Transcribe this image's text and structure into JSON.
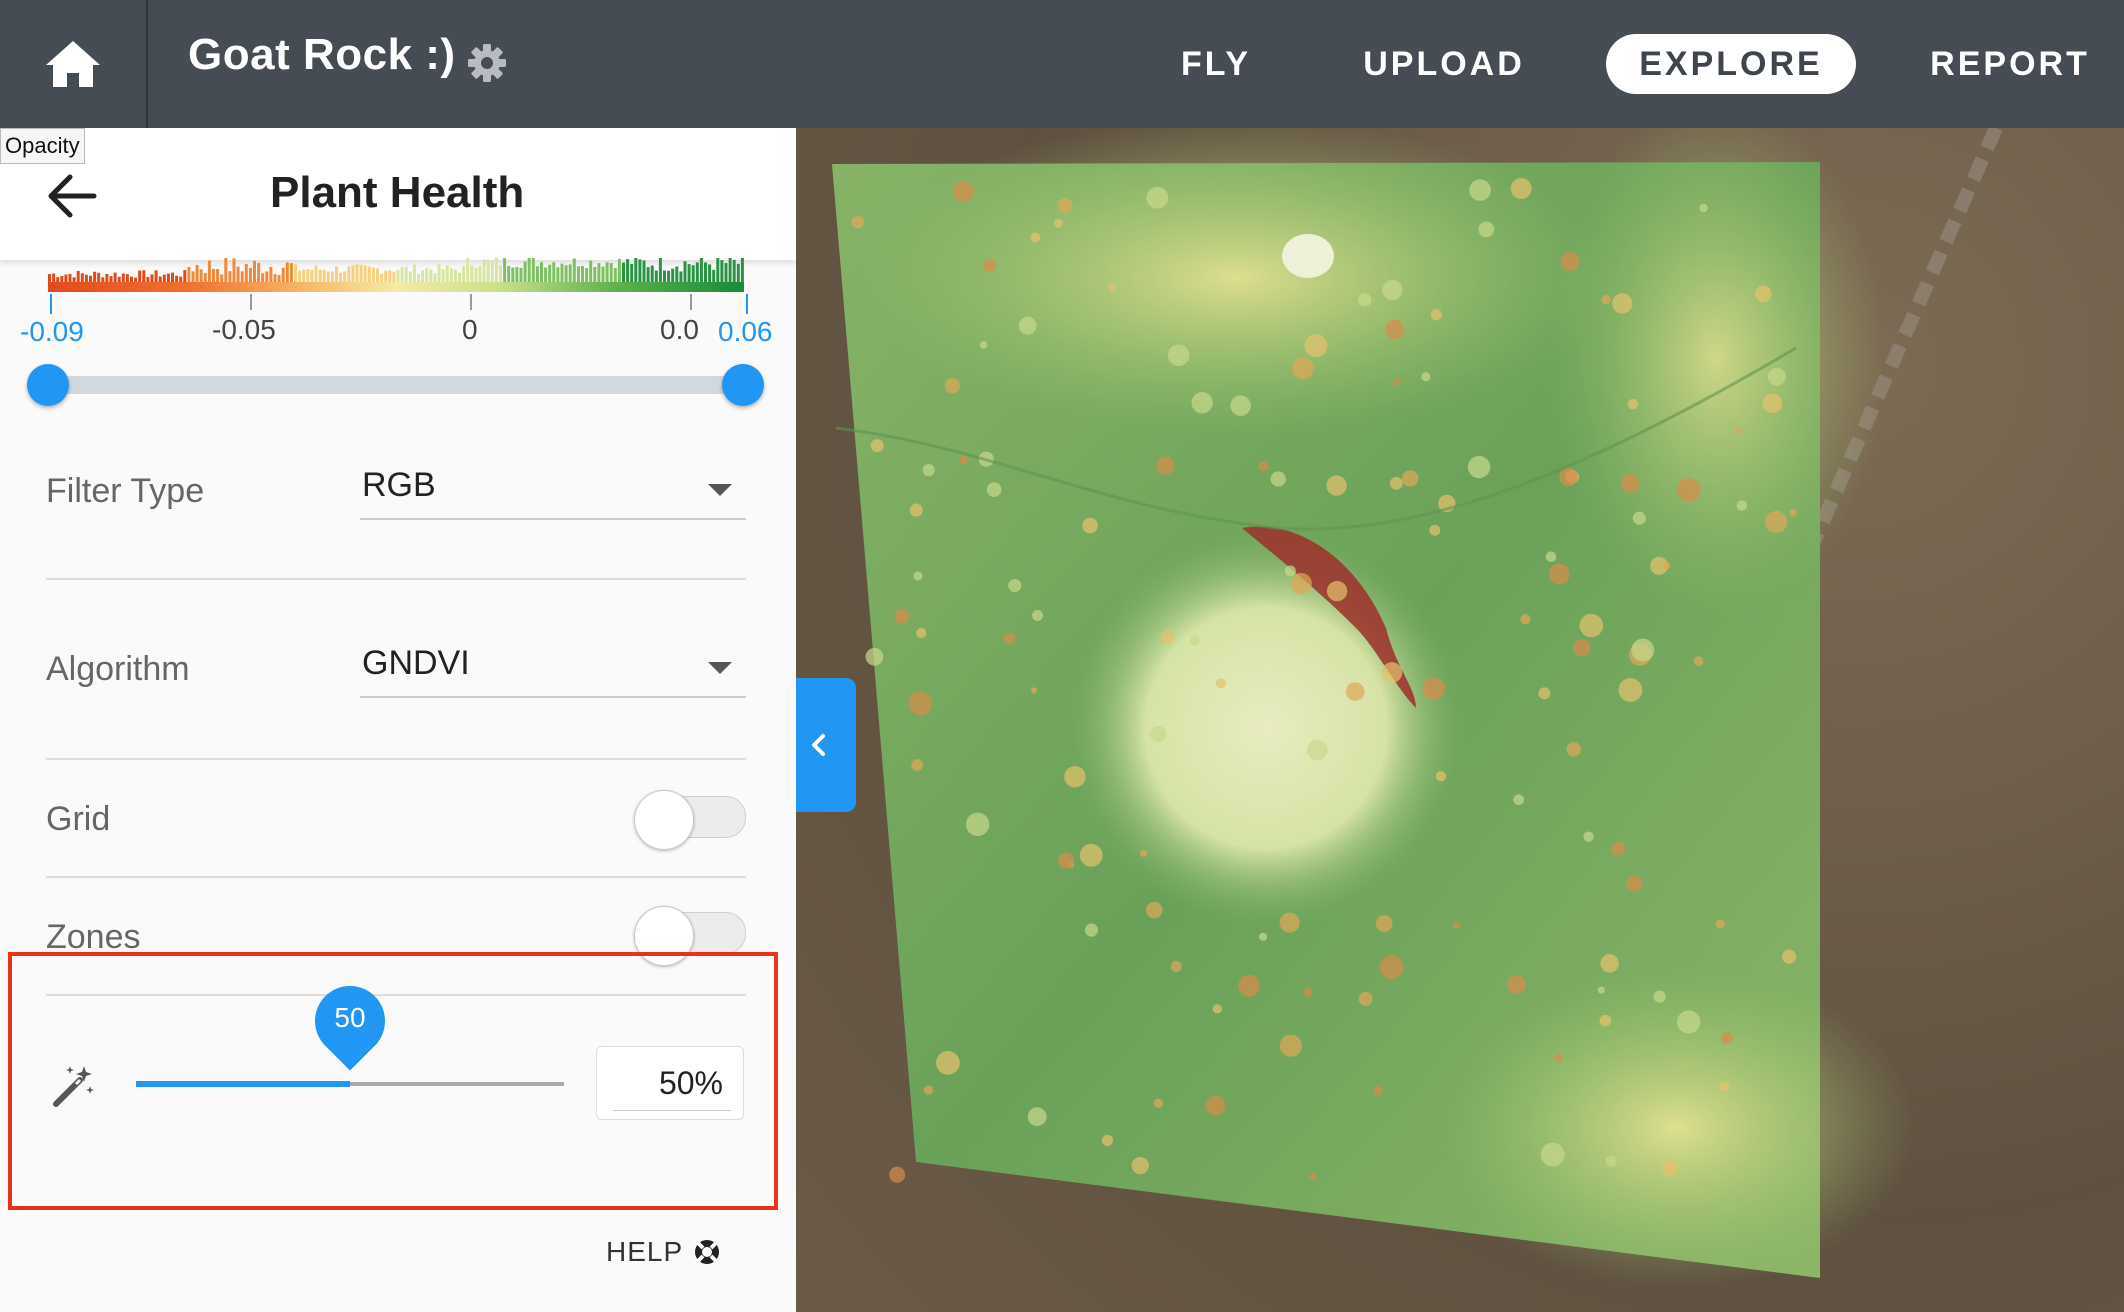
{
  "header": {
    "project_title": "Goat Rock :)",
    "nav": [
      {
        "label": "FLY",
        "active": false
      },
      {
        "label": "UPLOAD",
        "active": false
      },
      {
        "label": "EXPLORE",
        "active": true
      },
      {
        "label": "REPORT",
        "active": false
      }
    ]
  },
  "tooltip": "Opacity",
  "panel": {
    "title": "Plant Health",
    "legend": {
      "min": "-0.09",
      "max": "0.06",
      "ticks": [
        "-0.05",
        "0",
        "0.0"
      ]
    },
    "filter_type": {
      "label": "Filter Type",
      "value": "RGB"
    },
    "algorithm": {
      "label": "Algorithm",
      "value": "GNDVI"
    },
    "grid": {
      "label": "Grid",
      "on": false
    },
    "zones": {
      "label": "Zones",
      "on": false
    },
    "opacity": {
      "value": 50,
      "pin_label": "50",
      "input_value": "50%"
    },
    "help_label": "HELP"
  },
  "colors": {
    "topbar": "#464c54",
    "accent": "#2196f3",
    "highlight": "#e8321e"
  },
  "icons": {
    "home": "home-icon",
    "settings": "gear-icon",
    "back": "back-arrow-icon",
    "opacity": "magic-wand-icon",
    "help": "lifebuoy-icon",
    "collapse": "chevron-left-icon"
  }
}
